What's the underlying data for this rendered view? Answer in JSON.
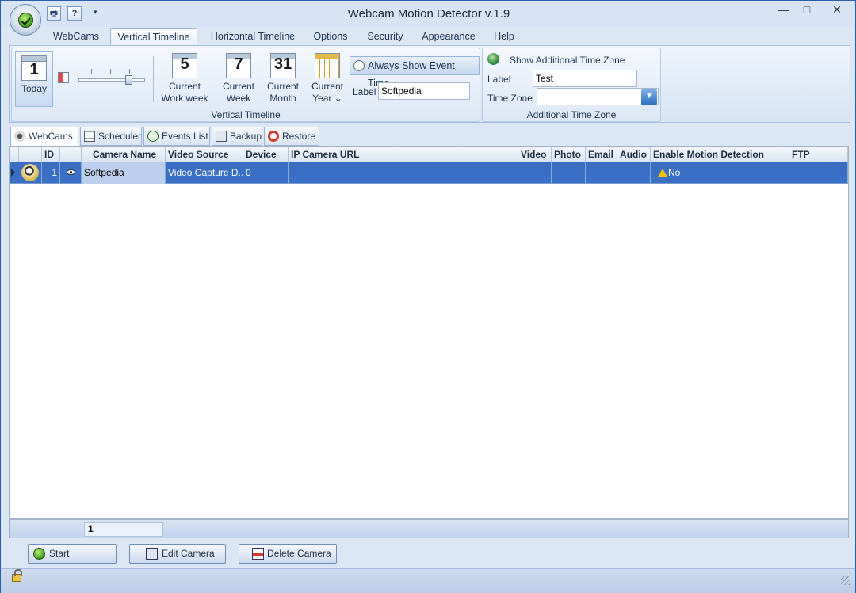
{
  "window": {
    "title": "Webcam Motion Detector v.1.9",
    "minimize_glyph": "—",
    "maximize_glyph": "□",
    "close_glyph": "✕"
  },
  "qat": {
    "print_icon": "printer-icon",
    "help_icon": "help-icon",
    "help_glyph": "?",
    "customize_glyph": "▾"
  },
  "ribbon_tabs": [
    "WebCams",
    "Vertical Timeline",
    "Horizontal Timeline",
    "Options",
    "Security",
    "Appearance",
    "Help"
  ],
  "active_ribbon_tab": "Vertical Timeline",
  "vertical_timeline": {
    "today": {
      "number": "1",
      "label": "Today"
    },
    "work_week": {
      "number": "5",
      "line1": "Current",
      "line2": "Work week"
    },
    "week": {
      "number": "7",
      "line1": "Current",
      "line2": "Week"
    },
    "month": {
      "number": "31",
      "line1": "Current",
      "line2": "Month"
    },
    "year": {
      "line1": "Current",
      "line2": "Year ⌄"
    },
    "always_show_event_time": "Always Show Event Time",
    "label_caption": "Label",
    "label_value": "Softpedia",
    "slider_level": 0.78,
    "group_label": "Vertical Timeline"
  },
  "additional_time_zone": {
    "show_label": "Show Additional Time Zone",
    "label_caption": "Label",
    "label_value": "Test",
    "time_zone_caption": "Time Zone",
    "time_zone_value": "",
    "group_label": "Additional Time Zone"
  },
  "sub_tabs": [
    "WebCams",
    "Scheduler",
    "Events List",
    "Backup",
    "Restore"
  ],
  "active_sub_tab": "WebCams",
  "table": {
    "columns": [
      "ID",
      "Camera Name",
      "Video Source",
      "Device",
      "IP Camera URL",
      "Video",
      "Photo",
      "Email",
      "Audio",
      "Enable Motion Detection",
      "FTP"
    ],
    "rows": [
      {
        "id": "1",
        "camera_name": "Softpedia",
        "video_source": "Video Capture D...",
        "device": "0",
        "ip_camera_url": "",
        "video": "",
        "photo": "",
        "email": "",
        "audio": "",
        "enable_motion_detection": "No",
        "ftp": ""
      }
    ],
    "footer_count": "1"
  },
  "actions": {
    "start_monitoring": "Start Monitoring",
    "edit_camera": "Edit Camera",
    "delete_camera": "Delete Camera"
  },
  "colors": {
    "selected_row": "#3a6fc4",
    "ribbon_bg": "#dbe7f5",
    "accent_green": "#3e9a1b"
  }
}
